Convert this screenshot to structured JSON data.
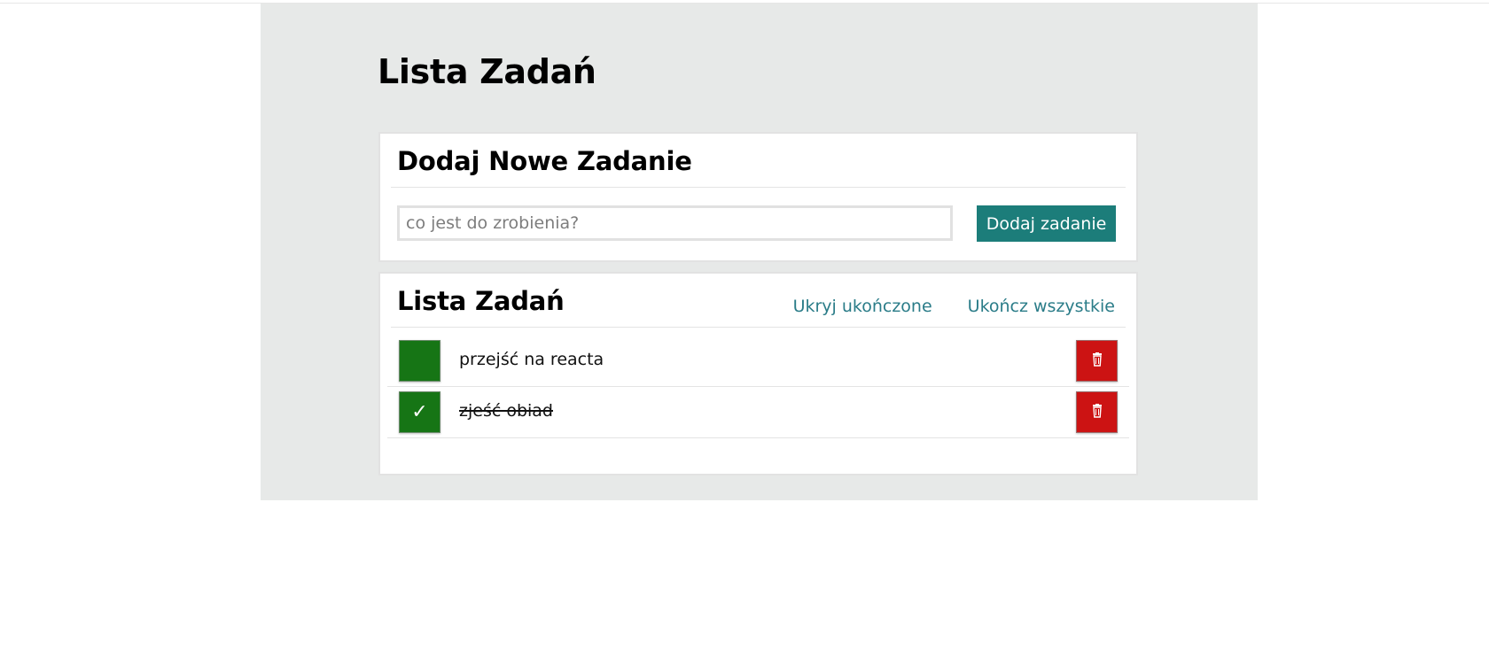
{
  "page": {
    "title": "Lista Zadań"
  },
  "add_card": {
    "heading": "Dodaj Nowe Zadanie",
    "input_value": "",
    "input_placeholder": "co jest do zrobienia?",
    "button_label": "Dodaj zadanie"
  },
  "list_card": {
    "heading": "Lista Zadań",
    "hide_completed_label": "Ukryj ukończone",
    "complete_all_label": "Ukończ wszystkie",
    "tasks": [
      {
        "text": "przejść na reacta",
        "completed": false,
        "check_mark": ""
      },
      {
        "text": "zjeść obiad",
        "completed": true,
        "check_mark": "✓"
      }
    ]
  },
  "icons": {
    "delete": "trash-icon",
    "check": "checkmark-icon"
  },
  "colors": {
    "background": "#e7e9e8",
    "accent_teal": "#1c7d7a",
    "link_teal": "#2a7c88",
    "checkbox_green": "#167515",
    "delete_red": "#cc1313"
  }
}
